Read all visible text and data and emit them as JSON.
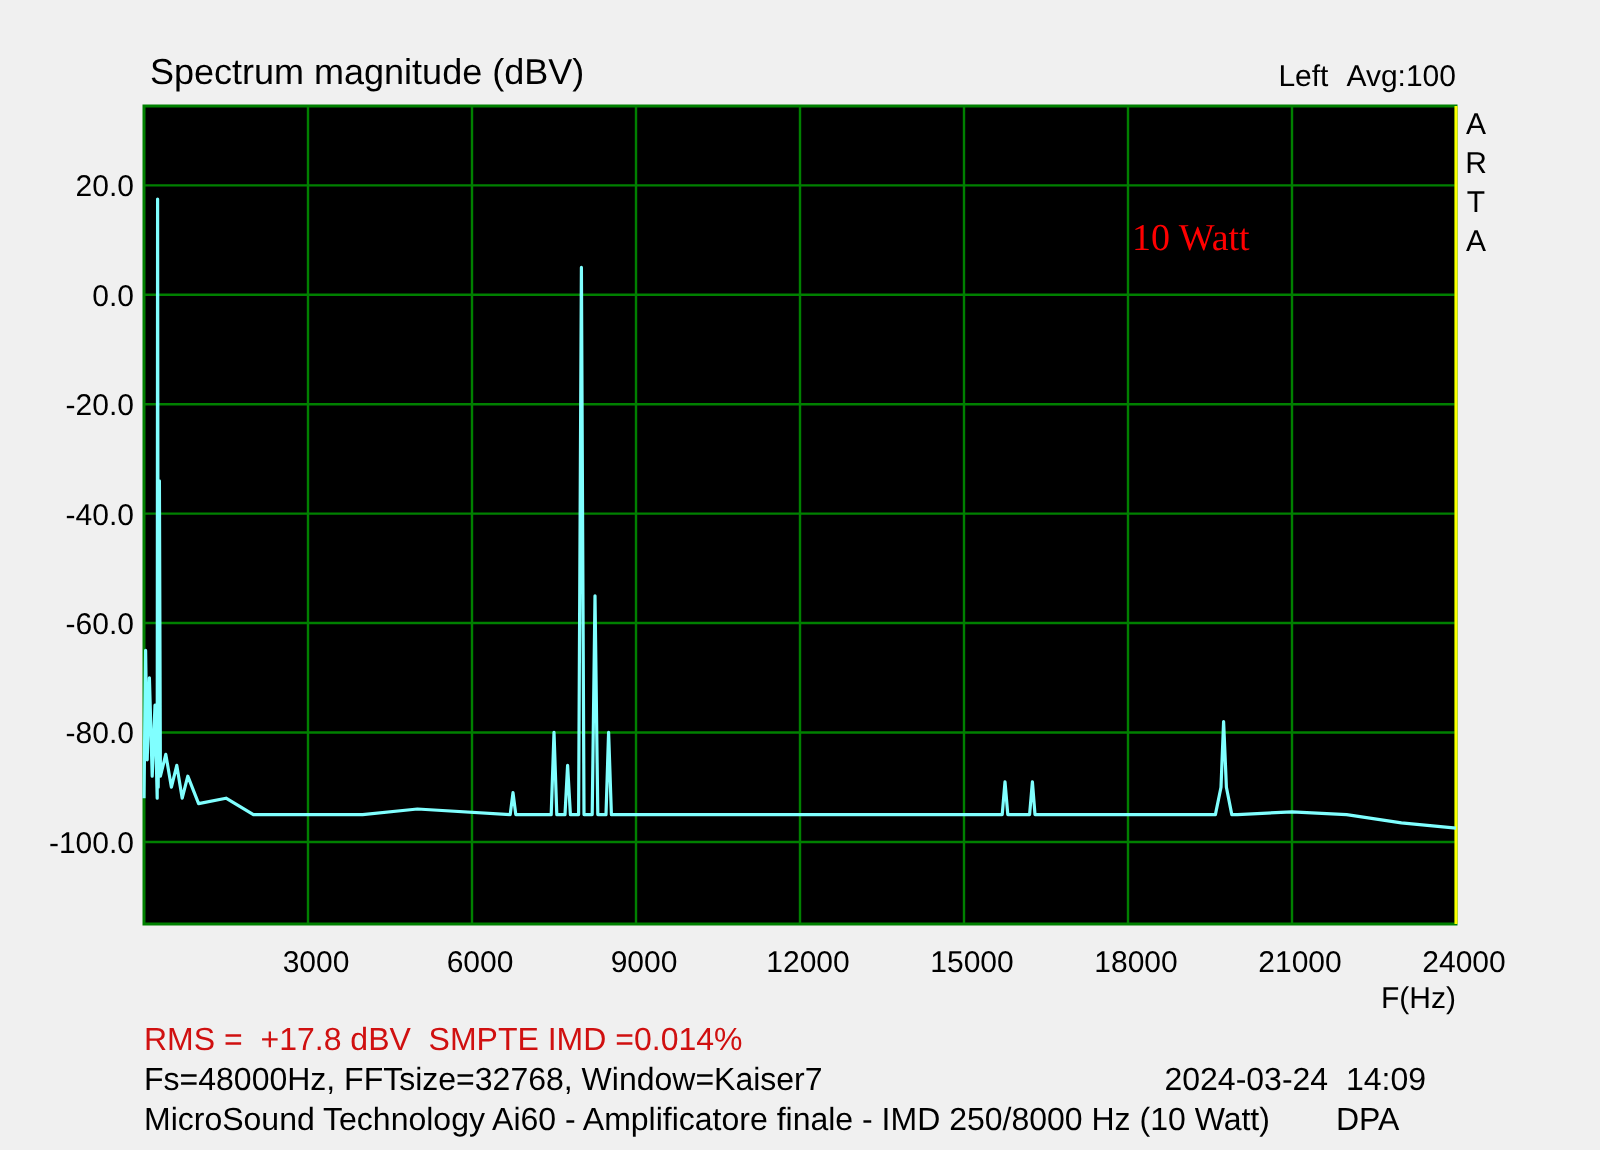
{
  "plot": {
    "averaging": "Avg:100",
    "side_label": "ARTA",
    "chart_data": {
      "type": "line",
      "title": "Spectrum magnitude (dBV)",
      "xlabel": "F(Hz)",
      "xlim": [
        0,
        24000
      ],
      "ylim": [
        -115,
        34.5
      ],
      "xticks": [
        3000,
        6000,
        9000,
        12000,
        15000,
        18000,
        21000,
        24000
      ],
      "yticks": [
        {
          "value": 20,
          "label": "20.0"
        },
        {
          "value": 0,
          "label": "0.0"
        },
        {
          "value": -20,
          "label": "-20.0"
        },
        {
          "value": -40,
          "label": "-40.0"
        },
        {
          "value": -60,
          "label": "-60.0"
        },
        {
          "value": -80,
          "label": "-80.0"
        },
        {
          "value": -100,
          "label": "-100.0"
        }
      ],
      "x": [
        0,
        30,
        60,
        100,
        150,
        200,
        240,
        250,
        260,
        280,
        300,
        400,
        500,
        600,
        700,
        800,
        1000,
        1500,
        2000,
        3000,
        4000,
        5000,
        6700,
        6750,
        6800,
        7450,
        7500,
        7550,
        7700,
        7750,
        7800,
        7950,
        8000,
        8050,
        8200,
        8250,
        8300,
        8450,
        8500,
        8550,
        9000,
        10000,
        12000,
        14000,
        15700,
        15750,
        15800,
        16200,
        16250,
        16300,
        18000,
        19600,
        19700,
        19750,
        19800,
        19900,
        20000,
        21000,
        22000,
        23000,
        24000
      ],
      "series": [
        {
          "name": "Left",
          "color": "#80ffff",
          "values": [
            -92,
            -65,
            -85,
            -70,
            -88,
            -75,
            -92,
            17.5,
            -90,
            -34,
            -88,
            -84,
            -90,
            -86,
            -92,
            -88,
            -93,
            -92,
            -95,
            -95,
            -95,
            -94,
            -95,
            -91,
            -95,
            -95,
            -80,
            -95,
            -95,
            -86,
            -95,
            -95,
            5,
            -95,
            -95,
            -55,
            -95,
            -95,
            -80,
            -95,
            -95,
            -95,
            -95,
            -95,
            -95,
            -89,
            -95,
            -95,
            -89,
            -95,
            -95,
            -95,
            -90,
            -78,
            -90,
            -95,
            -95,
            -94.5,
            -95,
            -96.5,
            -97.5
          ]
        }
      ],
      "grid": true,
      "annotations": [
        "10 Watt"
      ]
    }
  },
  "footer": {
    "measurement": "RMS =  +17.8 dBV  SMPTE IMD =0.014%",
    "settings": "Fs=48000Hz, FFTsize=32768, Window=Kaiser7",
    "timestamp": "2024-03-24  14:09",
    "description": "MicroSound Technology Ai60 - Amplificatore finale - IMD 250/8000 Hz (10 Watt)",
    "mode": "DPA"
  }
}
